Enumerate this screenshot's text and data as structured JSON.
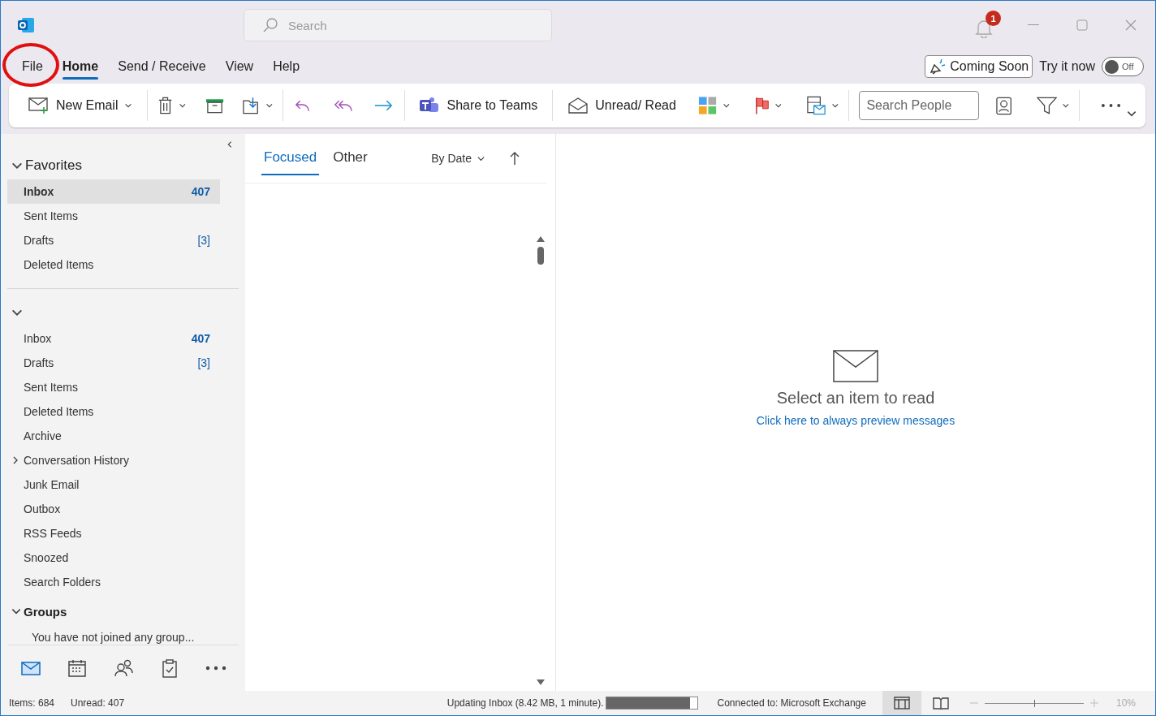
{
  "title_bar": {
    "search_placeholder": "Search",
    "notification_count": "1"
  },
  "ribbon_tabs": [
    {
      "label": "File",
      "selected": false,
      "circled": true
    },
    {
      "label": "Home",
      "selected": true,
      "circled": false
    },
    {
      "label": "Send / Receive",
      "selected": false,
      "circled": false
    },
    {
      "label": "View",
      "selected": false,
      "circled": false
    },
    {
      "label": "Help",
      "selected": false,
      "circled": false
    }
  ],
  "coming_soon": {
    "label": "Coming Soon",
    "try_label": "Try it now",
    "toggle_label": "Off",
    "on": false
  },
  "toolbar": {
    "new_email": "New Email",
    "share": "Share to Teams",
    "unread_read": "Unread/ Read",
    "search_people_placeholder": "Search People"
  },
  "sidebar": {
    "favorites": {
      "title": "Favorites",
      "expanded": true,
      "items": [
        {
          "label": "Inbox",
          "count": "407",
          "unread": true,
          "selected": true
        },
        {
          "label": "Sent Items",
          "selected": false
        },
        {
          "label": "Drafts",
          "count": "[3]",
          "unread": false,
          "selected": false
        },
        {
          "label": "Deleted Items",
          "selected": false
        }
      ]
    },
    "account": {
      "expanded": true,
      "items": [
        {
          "label": "Inbox",
          "count": "407",
          "unread": true,
          "selected": false
        },
        {
          "label": "Drafts",
          "count": "[3]",
          "unread": false,
          "selected": false
        },
        {
          "label": "Sent Items",
          "selected": false
        },
        {
          "label": "Deleted Items",
          "selected": false
        },
        {
          "label": "Archive",
          "selected": false
        },
        {
          "label": "Conversation History",
          "selected": false,
          "expanded": false
        },
        {
          "label": "Junk Email",
          "selected": false
        },
        {
          "label": "Outbox",
          "selected": false
        },
        {
          "label": "RSS Feeds",
          "selected": false
        },
        {
          "label": "Snoozed",
          "selected": false
        },
        {
          "label": "Search Folders",
          "selected": false
        }
      ]
    },
    "groups": {
      "title": "Groups",
      "expanded": true,
      "note": "You have not joined any group..."
    },
    "nav": [
      {
        "kind": "mail",
        "selected": true
      },
      {
        "kind": "calendar",
        "selected": false
      },
      {
        "kind": "people",
        "selected": false
      },
      {
        "kind": "tasks",
        "selected": false
      },
      {
        "kind": "more",
        "selected": false
      }
    ]
  },
  "message_list": {
    "tabs": [
      {
        "label": "Focused",
        "selected": true
      },
      {
        "label": "Other",
        "selected": false
      }
    ],
    "sort": "By Date"
  },
  "reading_pane": {
    "title": "Select an item to read",
    "link": "Click here to always preview messages"
  },
  "status_bar": {
    "items": "Items: 684",
    "unread": "Unread: 407",
    "progress_text": "Updating Inbox (8.42 MB, 1 minute).",
    "progress": {
      "level": 0.92
    },
    "connection": "Connected to: Microsoft Exchange",
    "views": [
      {
        "kind": "normal",
        "selected": true
      },
      {
        "kind": "reading",
        "selected": false
      }
    ],
    "zoom": {
      "level": 0.5
    },
    "zoom_text": "10%"
  }
}
